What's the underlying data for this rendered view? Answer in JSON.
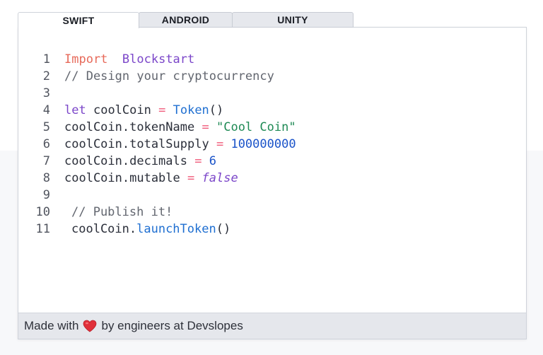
{
  "tabs": [
    {
      "label": "SWIFT",
      "active": true
    },
    {
      "label": "ANDROID",
      "active": false
    },
    {
      "label": "UNITY",
      "active": false
    }
  ],
  "code": {
    "line_numbers": [
      "1",
      "2",
      "3",
      "4",
      "5",
      "6",
      "7",
      "8",
      "9",
      "10",
      "11"
    ],
    "l1_import": "Import",
    "l1_module": "Blockstart",
    "l2_comment": "// Design your cryptocurrency",
    "l4_let": "let",
    "l4_var": "coolCoin",
    "l4_eq": "=",
    "l4_type": "Token",
    "l4_parens": "()",
    "l5_prop": "coolCoin.tokenName",
    "l5_eq": "=",
    "l5_value": "\"Cool Coin\"",
    "l6_prop": "coolCoin.totalSupply",
    "l6_eq": "=",
    "l6_value": "100000000",
    "l7_prop": "coolCoin.decimals",
    "l7_eq": "=",
    "l7_value": "6",
    "l8_prop": "coolCoin.mutable",
    "l8_eq": "=",
    "l8_value": "false",
    "l10_comment": "// Publish it!",
    "l11_obj": "coolCoin.",
    "l11_method": "launchToken",
    "l11_parens": "()"
  },
  "footer": {
    "prefix": "Made with",
    "heart_icon": "heart-icon",
    "suffix": "by engineers at Devslopes"
  },
  "colors": {
    "keyword_red": "#e76a5a",
    "keyword_purple": "#7b46c9",
    "type_blue": "#1f6fd1",
    "string_green": "#1f8a55",
    "number_blue": "#1a53c9",
    "operator_pink": "#f05a7a",
    "heart_red": "#e0303a"
  }
}
